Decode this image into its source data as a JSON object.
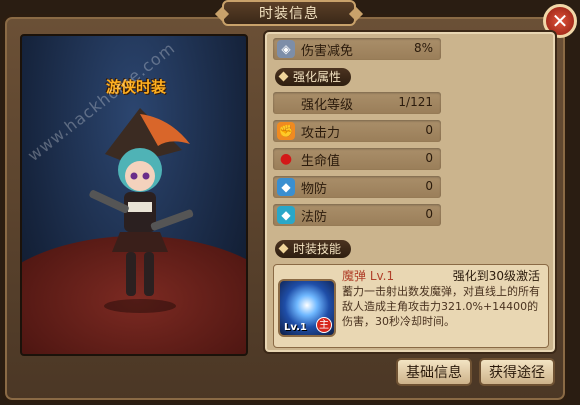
{
  "window": {
    "title": "时装信息",
    "close_glyph": "✕"
  },
  "preview": {
    "costume_name": "游侠时装"
  },
  "stats": [
    {
      "icon": "shield-icon",
      "label": "伤害减免",
      "value": "8%"
    },
    {
      "icon": "level-icon",
      "label": "强化等级",
      "value": "1/121"
    },
    {
      "icon": "attack-icon",
      "label": "攻击力",
      "value": "0"
    },
    {
      "icon": "blood-drop-icon",
      "label": "生命值",
      "value": "0"
    },
    {
      "icon": "physical-defense-icon",
      "label": "物防",
      "value": "0"
    },
    {
      "icon": "magic-defense-icon",
      "label": "法防",
      "value": "0"
    }
  ],
  "sections": {
    "enhance": "强化属性",
    "skill": "时装技能"
  },
  "skill": {
    "name": "魔弹 Lv.1",
    "unlock": "强化到30级激活",
    "level_badge": "Lv.1",
    "role_badge": "主",
    "description": "蓄力一击射出数发魔弹，对直线上的所有敌人造成主角攻击力321.0%+14400的伤害，30秒冷却时间。"
  },
  "buttons": {
    "basic_info": "基础信息",
    "get_path": "获得途径"
  },
  "watermark": "www.hackhome.com"
}
